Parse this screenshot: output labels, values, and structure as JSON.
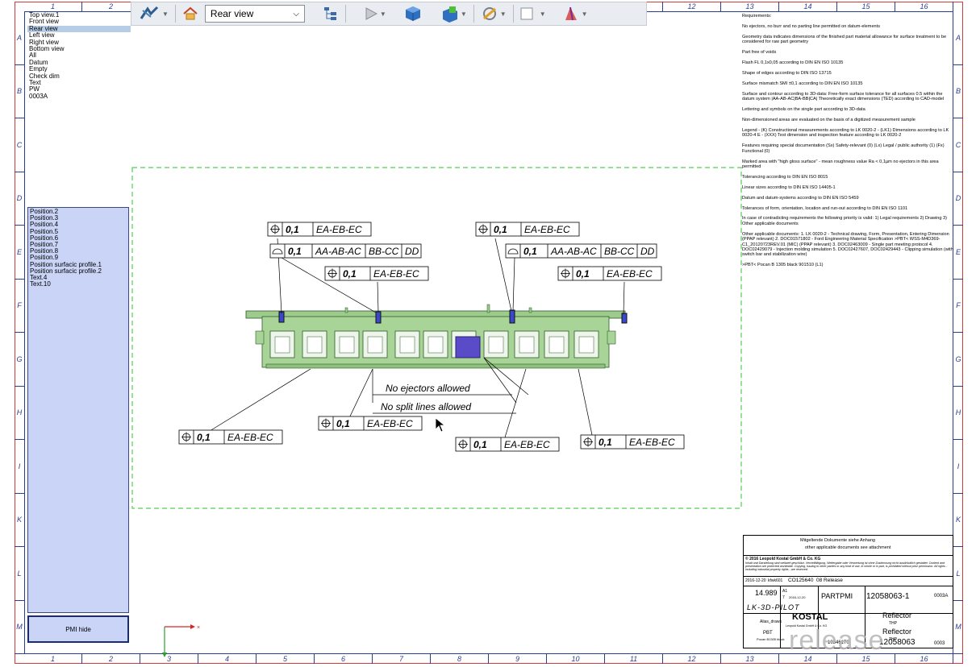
{
  "ruler": {
    "cols": [
      "1",
      "2",
      "3",
      "4",
      "5",
      "6",
      "7",
      "8",
      "9",
      "10",
      "11",
      "12",
      "13",
      "14",
      "15",
      "16"
    ],
    "rows": [
      "A",
      "B",
      "C",
      "D",
      "E",
      "F",
      "G",
      "H",
      "I",
      "K",
      "L",
      "M"
    ]
  },
  "toolbar": {
    "view_value": "Rear view",
    "icons": [
      "select-icon",
      "home-icon",
      "view-select",
      "tree-icon",
      "play-icon",
      "cube-icon",
      "section-icon",
      "measure-icon",
      "checkbox-icon",
      "color-icon"
    ]
  },
  "views": [
    {
      "label": "Top view.1",
      "selected": false
    },
    {
      "label": "Front view",
      "selected": false
    },
    {
      "label": "Rear view",
      "selected": true
    },
    {
      "label": "Left view",
      "selected": false
    },
    {
      "label": "Right view",
      "selected": false
    },
    {
      "label": "Bottom view",
      "selected": false
    },
    {
      "label": "All",
      "selected": false
    },
    {
      "label": "Datum",
      "selected": false
    },
    {
      "label": "Empty",
      "selected": false
    },
    {
      "label": "Check dim",
      "selected": false
    },
    {
      "label": "Text",
      "selected": false
    },
    {
      "label": "PW",
      "selected": false
    },
    {
      "label": "0003A",
      "selected": false
    }
  ],
  "captures": [
    "Position.2",
    "Position.3",
    "Position.4",
    "Position.5",
    "Position.6",
    "Position.7",
    "Position.8",
    "Position.9",
    "Position surfacic profile.1",
    "Position surfacic profile.2",
    "Text.4",
    "Text.10"
  ],
  "pmi_hide_label": "PMI hide",
  "annotations": {
    "fcf_value": "0,1",
    "fcf_datum": "EA-EB-EC",
    "profile_datums": [
      "AA-AB-AC",
      "BB-CC",
      "DD"
    ],
    "no_ejectors": "No ejectors allowed",
    "no_split": "No split lines allowed"
  },
  "notes": [
    "Requirements:",
    "No ejectors, no burr and no parting line permitted on datum-elements",
    "Geometry data indicates dimensions of the finished part material allowance for surface treatment to be considered for raw part geometry",
    "Part free of voids",
    "Flash FL 0,1x0,05 according to DIN EN ISO 10135",
    "Shape of edges according to DIN ISO 13715",
    "Surface mismatch SMI ±0,1 according to DIN EN ISO 10135",
    "Surface and contour according to 3D-data: Free-form surface tolerance for all surfaces 0.5 within the datum system |AA-AB-AC|BA-BB|CA| Theoretically exact dimensions (TED) according to CAD-model",
    "Lettering and symbols on the single part according to 3D-data",
    "Non-dimensioned areas are evaluated on the basis of a digitized measurement sample",
    "Legend - (K) Constructional measurements according to LK 0020-2 - (LK1) Dimensions according to LK 0020-4 E - (XXX) Test dimension and inspection feature according to LK 0020-2",
    "Features requiring special documentation (Sx) Safety-relevant (0) (Lx) Legal / public authority (1) (Fx) Functional (0)",
    "Marked area with \"high gloss surface\" - mean roughness value Ra < 0,1µm no ejectors in this area permitted",
    "Tolerancing according to DIN EN ISO 8015",
    "Linear sizes according to DIN EN ISO 14405-1",
    "Datum and datum-systems according to DIN EN ISO 5459",
    "Tolerances of form, orientation, location and run-out according to DIN EN ISO 1101",
    "In case of contradicting requirements the following priority is valid: 1) Legal requirements 2) Drawing 3) Other applicable documents",
    "Other applicable documents: 1. LK 0020-2 - Technical drawing, Form, Presentation, Entering Dimension (PPAP relevant) 2. DOC01571802 - Ford Engineering Material Specification >PBT< WSS-M4D369-C1_20120723REV.01 (MIC) (PPAP relevant) 3. DOC02463009 - Single part meeting protocol 4. DOC02429079 - Injection molding simulation 5. DOC02427607, DOC02429443 - Clipping simulation (with switch bar and stabilization wire)",
    ">PBT< Pocan B 1305 black 901510 (L1)"
  ],
  "title_block": {
    "doc_header_1": "Mitgeltende Dokumente siehe Anhang",
    "doc_header_2": "other applicable documents see attachment",
    "copyright": "© 2016 Leopold Kostal GmbH & Co. KG",
    "copyright_text": "Inhalt und Darstellung sind weltweit geschützt. Vervielfältigung, Weitergabe oder Verwertung ist ohne Zustimmung nicht ausdrücklich gestattet. Content and presentation are protected worldwide. Copying, issuing to other parties or any kind of use, in whole or in part, is prohibited without prior permission. All rights - including industrial property rights - are reserved.",
    "date": "2016-12-20",
    "user": "kfwk601",
    "change_no": "CO125640",
    "status": "08 Release",
    "weight": "14.989",
    "sheet": "A1",
    "rev": "7",
    "rev_date": "2016-12-20",
    "kind": "PARTPMI",
    "number": "12058063-1",
    "index": "0003A",
    "standard": "LK-3D-PILOT",
    "material": "PBT",
    "material_note": "Pocan B1305 black",
    "alias": "Alias_draws",
    "name": "Reflector",
    "name_sub": "THP",
    "company": "KOSTAL",
    "company_addr": "Leopold Kostal GmbH & Co. KG",
    "watermark": "release",
    "ident": "10346170",
    "part_no": "12058063",
    "part_index": "0003"
  }
}
